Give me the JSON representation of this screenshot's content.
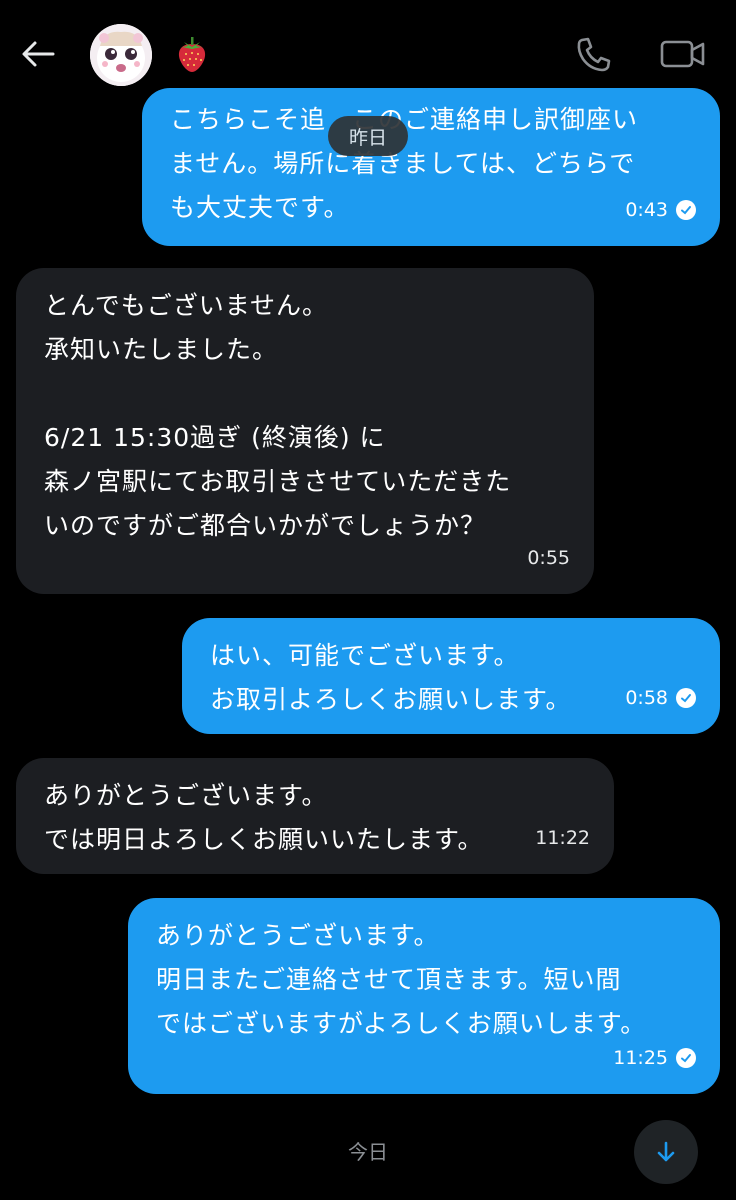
{
  "header": {
    "contact_emoji": "🍓",
    "icons": {
      "back": "back-arrow-icon",
      "call": "phone-icon",
      "video": "video-camera-icon"
    }
  },
  "date_separator_top": "昨日",
  "messages": [
    {
      "direction": "outgoing",
      "text": "こちらこそ追　このご連絡申し訳御座い\nません。場所に着きましては、どちらで\nも大丈夫です。",
      "time": "0:43",
      "read": true
    },
    {
      "direction": "incoming",
      "text": "とんでもございません。\n承知いたしました。\n\n6/21 15:30過ぎ (終演後) に\n森ノ宮駅にてお取引きさせていただきた\nいのですがご都合いかがでしょうか？",
      "time": "0:55"
    },
    {
      "direction": "outgoing",
      "text": "はい、可能でございます。\nお取引よろしくお願いします。",
      "time": "0:58",
      "read": true
    },
    {
      "direction": "incoming",
      "text": "ありがとうございます。\nでは明日よろしくお願いいたします。",
      "time": "11:22"
    },
    {
      "direction": "outgoing",
      "text": "ありがとうございます。\n明日またご連絡させて頂きます。短い間\nではございますがよろしくお願いします。",
      "time": "11:25",
      "read": true
    }
  ],
  "date_separator_bottom": "今日",
  "colors": {
    "background": "#000000",
    "outgoing_bubble": "#1d9bf0",
    "incoming_bubble": "#1c1e22",
    "date_pill": "#2f3336"
  },
  "scroll_button_icon": "arrow-down-icon"
}
